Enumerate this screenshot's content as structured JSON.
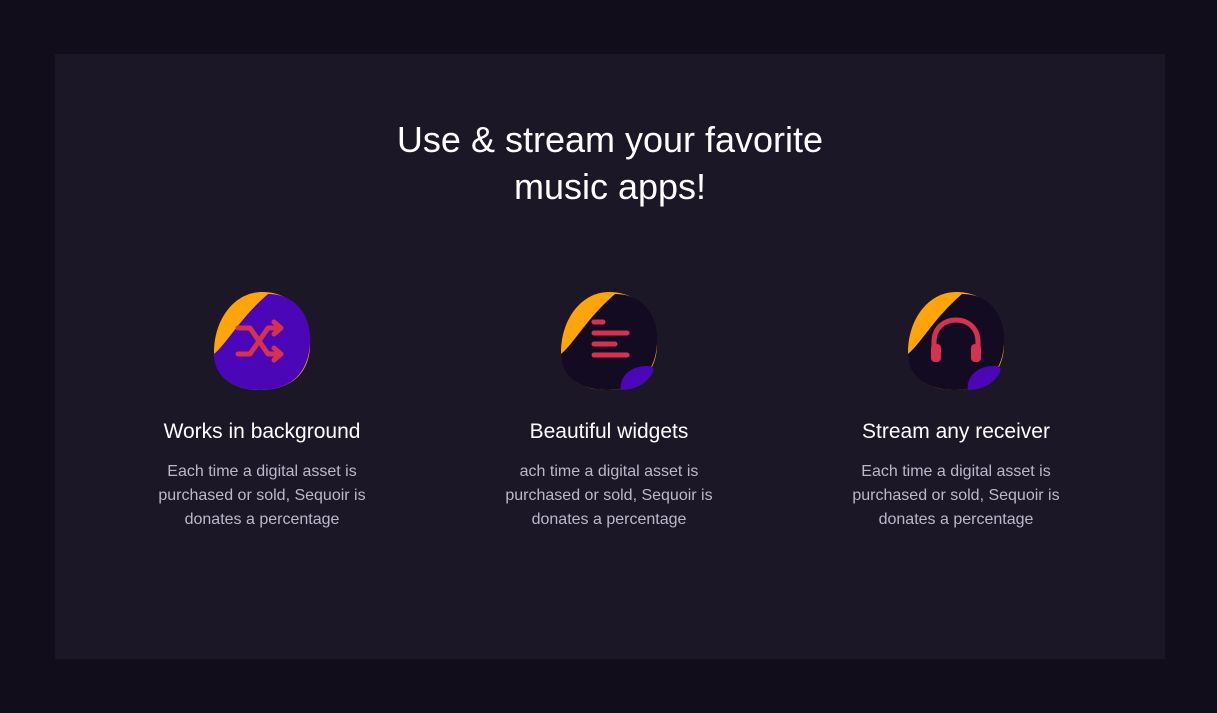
{
  "section": {
    "heading_line1": "Use & stream your favorite",
    "heading_line2": "music apps!"
  },
  "features": [
    {
      "title": "Works in background",
      "description": "Each time a digital asset is purchased or sold, Sequoir is donates a percentage",
      "icon": "shuffle-icon"
    },
    {
      "title": "Beautiful widgets",
      "description": "ach time a digital asset is purchased or sold, Sequoir is donates a percentage",
      "icon": "widgets-icon"
    },
    {
      "title": "Stream any receiver",
      "description": "Each time a digital asset is purchased or sold, Sequoir is donates a percentage",
      "icon": "headphones-icon"
    }
  ],
  "colors": {
    "page_background": "#110d1b",
    "panel_background": "#1c1726",
    "accent_orange": "#ffa40a",
    "accent_purple": "#4b06b8",
    "icon_red": "#d6314f",
    "blob_dark": "#130b21"
  }
}
